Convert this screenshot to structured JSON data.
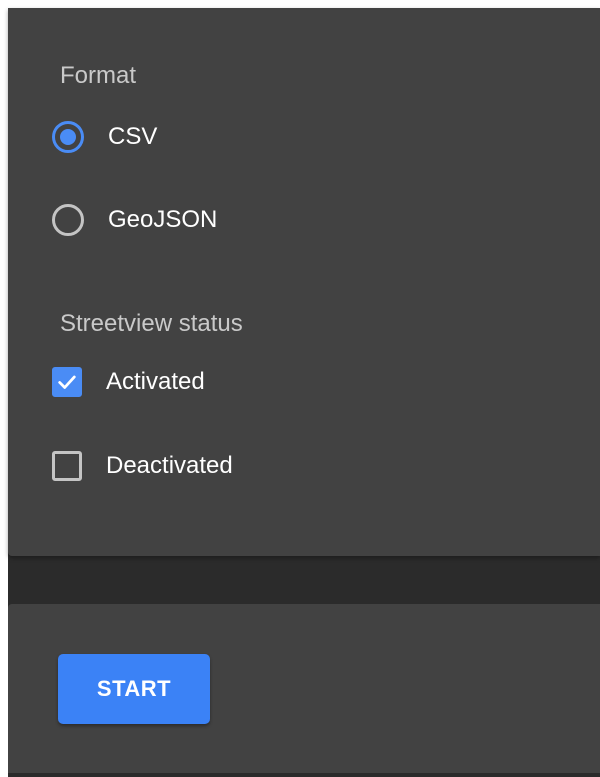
{
  "format": {
    "label": "Format",
    "options": [
      {
        "label": "CSV",
        "selected": true
      },
      {
        "label": "GeoJSON",
        "selected": false
      }
    ]
  },
  "streetview_status": {
    "label": "Streetview status",
    "options": [
      {
        "label": "Activated",
        "checked": true
      },
      {
        "label": "Deactivated",
        "checked": false
      }
    ]
  },
  "actions": {
    "start_label": "START"
  },
  "colors": {
    "accent": "#4a8cf5",
    "button": "#3b82f6",
    "card": "#424242",
    "background": "#2b2b2b"
  }
}
